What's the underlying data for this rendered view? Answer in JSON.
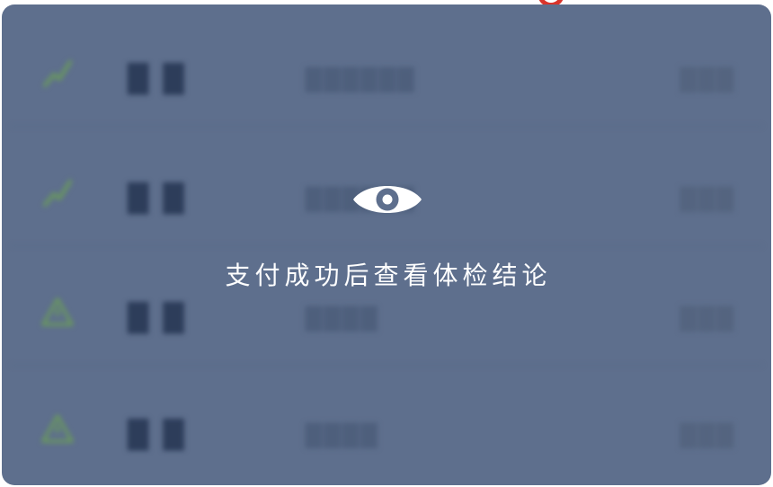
{
  "overlay": {
    "message": "支付成功后查看体检结论",
    "icon": "eye-icon"
  },
  "rows": [
    {
      "icon": "trend-up-icon",
      "name": "█ █",
      "desc": "██████",
      "value": "███"
    },
    {
      "icon": "trend-up-icon",
      "name": "█ █",
      "desc": "██████",
      "value": "███"
    },
    {
      "icon": "warning-icon",
      "name": "█ █",
      "desc": "████",
      "value": "███"
    },
    {
      "icon": "warning-icon",
      "name": "█ █",
      "desc": "████",
      "value": "███"
    }
  ],
  "colors": {
    "card_background": "#5e6f8d",
    "overlay_text": "#ffffff",
    "accent_mark": "#d9342b",
    "icon_green": "#6a9a5c"
  }
}
